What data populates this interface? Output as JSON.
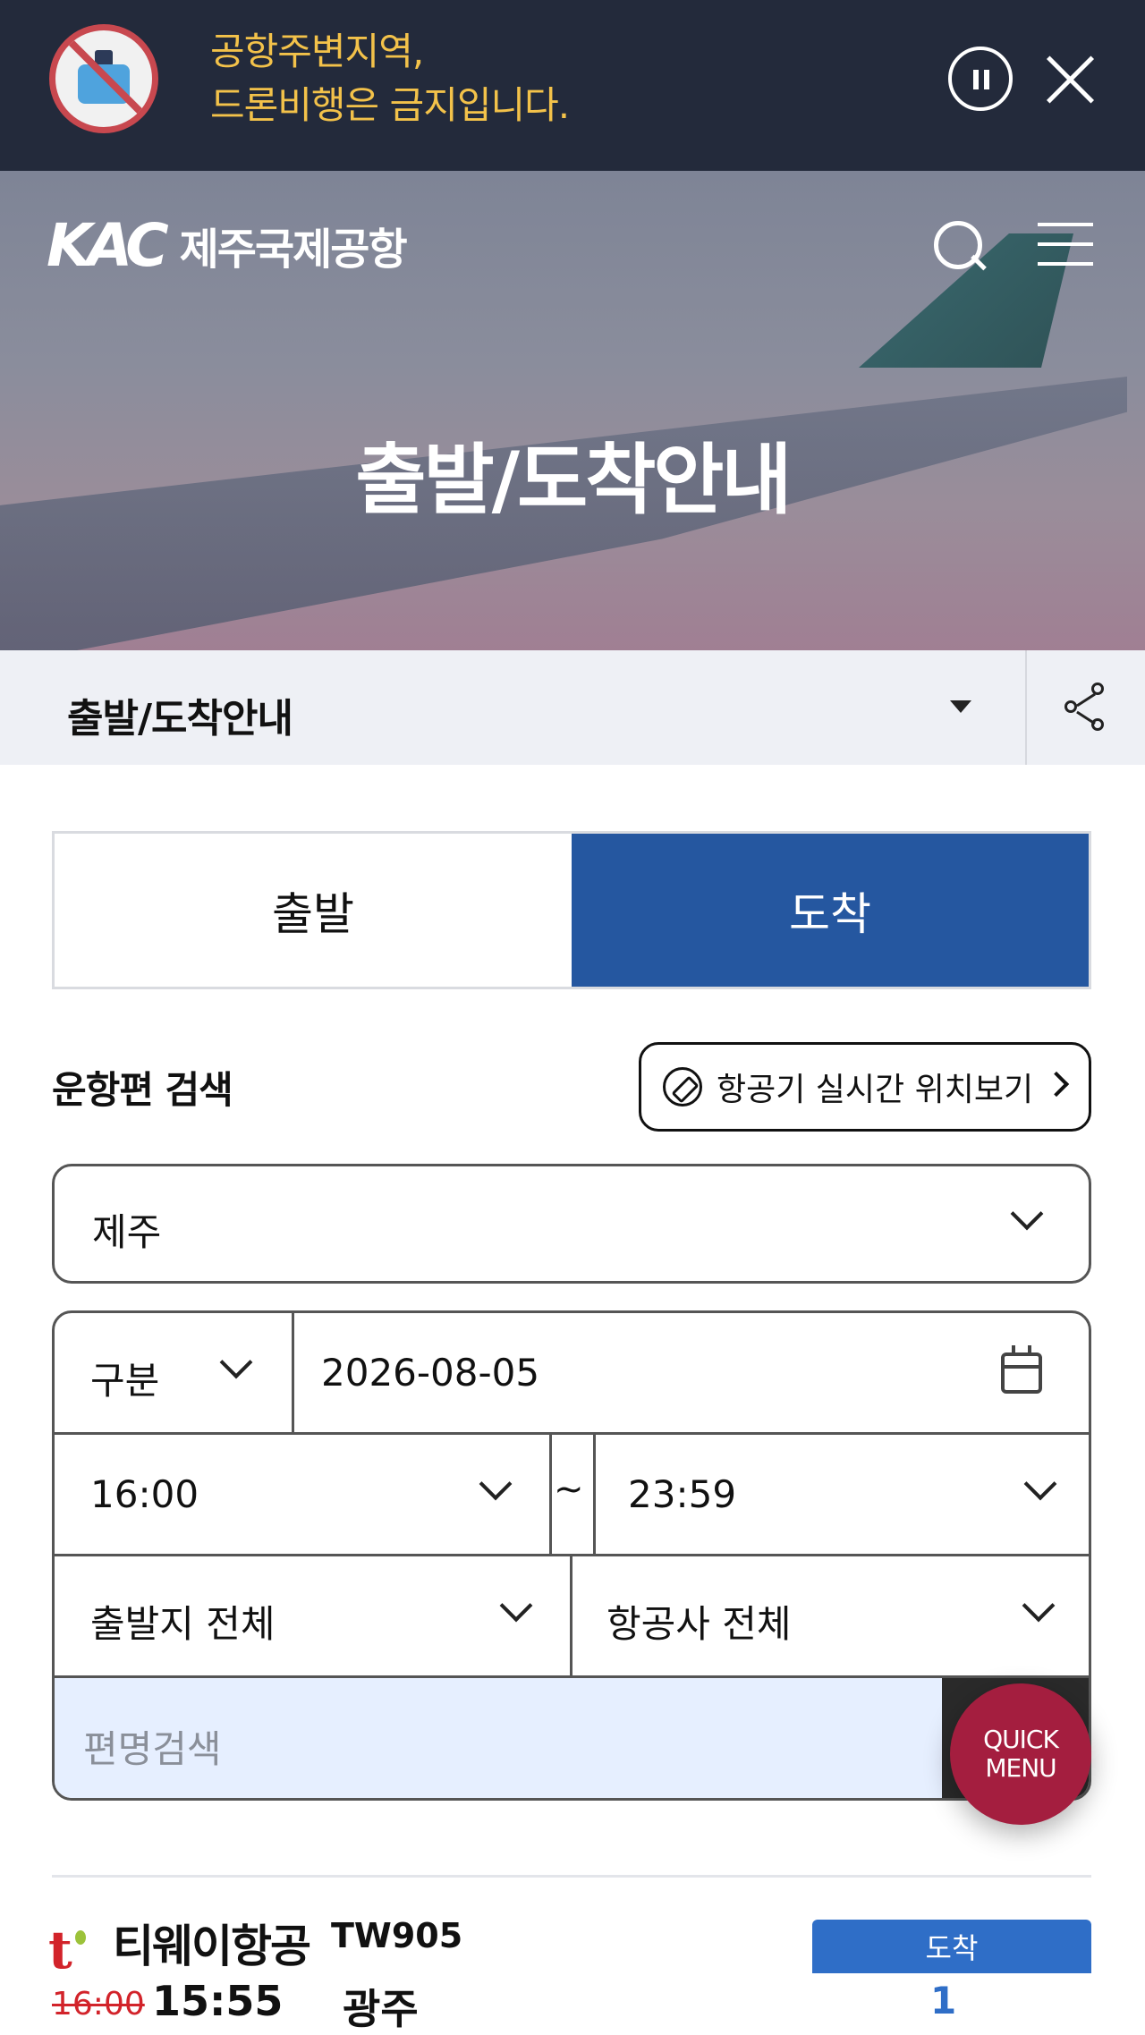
{
  "alert": {
    "line1": "공항주변지역,",
    "line2": "드론비행은 금지입니다."
  },
  "header": {
    "logo_mark": "KAC",
    "airport_name": "제주국제공항",
    "hero_title": "출발/도착안내"
  },
  "breadcrumb": {
    "label": "출발/도착안내"
  },
  "tabs": [
    {
      "label": "출발",
      "active": false
    },
    {
      "label": "도착",
      "active": true
    }
  ],
  "search": {
    "title": "운항편 검색",
    "live_button": "항공기 실시간 위치보기",
    "airport": "제주",
    "category": "구분",
    "date": "2026-08-05",
    "time_from": "16:00",
    "time_sep": "~",
    "time_to": "23:59",
    "origin": "출발지 전체",
    "airline": "항공사 전체",
    "flight_placeholder": "편명검색"
  },
  "quick_menu": {
    "line1": "QUICK",
    "line2": "MENU"
  },
  "flights": [
    {
      "airline": "티웨이항공",
      "flight_no": "TW905",
      "scheduled": "16:00",
      "actual": "15:55",
      "origin": "광주",
      "status": "도착",
      "gate": "1"
    }
  ],
  "colors": {
    "banner_bg": "#232a3b",
    "banner_text": "#f3c24a",
    "tab_active": "#2557a0",
    "status_blue": "#2f6ec7",
    "quick_menu": "#a41e3f",
    "delay_red": "#d2232a"
  }
}
